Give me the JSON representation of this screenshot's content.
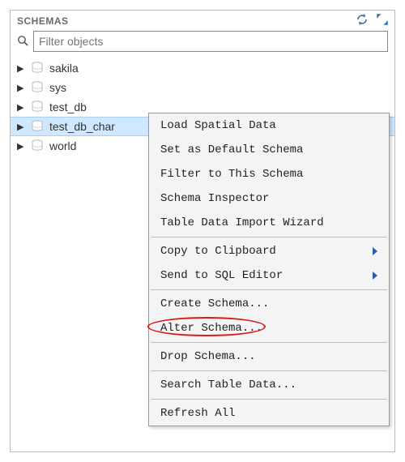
{
  "header": {
    "title": "SCHEMAS",
    "refresh_icon": "refresh",
    "expand_icon": "expand"
  },
  "search": {
    "placeholder": "Filter objects"
  },
  "schemas": [
    {
      "name": "sakila",
      "selected": false
    },
    {
      "name": "sys",
      "selected": false
    },
    {
      "name": "test_db",
      "selected": false
    },
    {
      "name": "test_db_char",
      "selected": true
    },
    {
      "name": "world",
      "selected": false
    }
  ],
  "context_menu": {
    "groups": [
      [
        {
          "label": "Load Spatial Data",
          "submenu": false
        },
        {
          "label": "Set as Default Schema",
          "submenu": false
        },
        {
          "label": "Filter to This Schema",
          "submenu": false
        },
        {
          "label": "Schema Inspector",
          "submenu": false
        },
        {
          "label": "Table Data Import Wizard",
          "submenu": false
        }
      ],
      [
        {
          "label": "Copy to Clipboard",
          "submenu": true
        },
        {
          "label": "Send to SQL Editor",
          "submenu": true
        }
      ],
      [
        {
          "label": "Create Schema...",
          "submenu": false
        },
        {
          "label": "Alter Schema...",
          "submenu": false,
          "highlighted": true
        }
      ],
      [
        {
          "label": "Drop Schema...",
          "submenu": false
        }
      ],
      [
        {
          "label": "Search Table Data...",
          "submenu": false
        }
      ],
      [
        {
          "label": "Refresh All",
          "submenu": false
        }
      ]
    ]
  }
}
